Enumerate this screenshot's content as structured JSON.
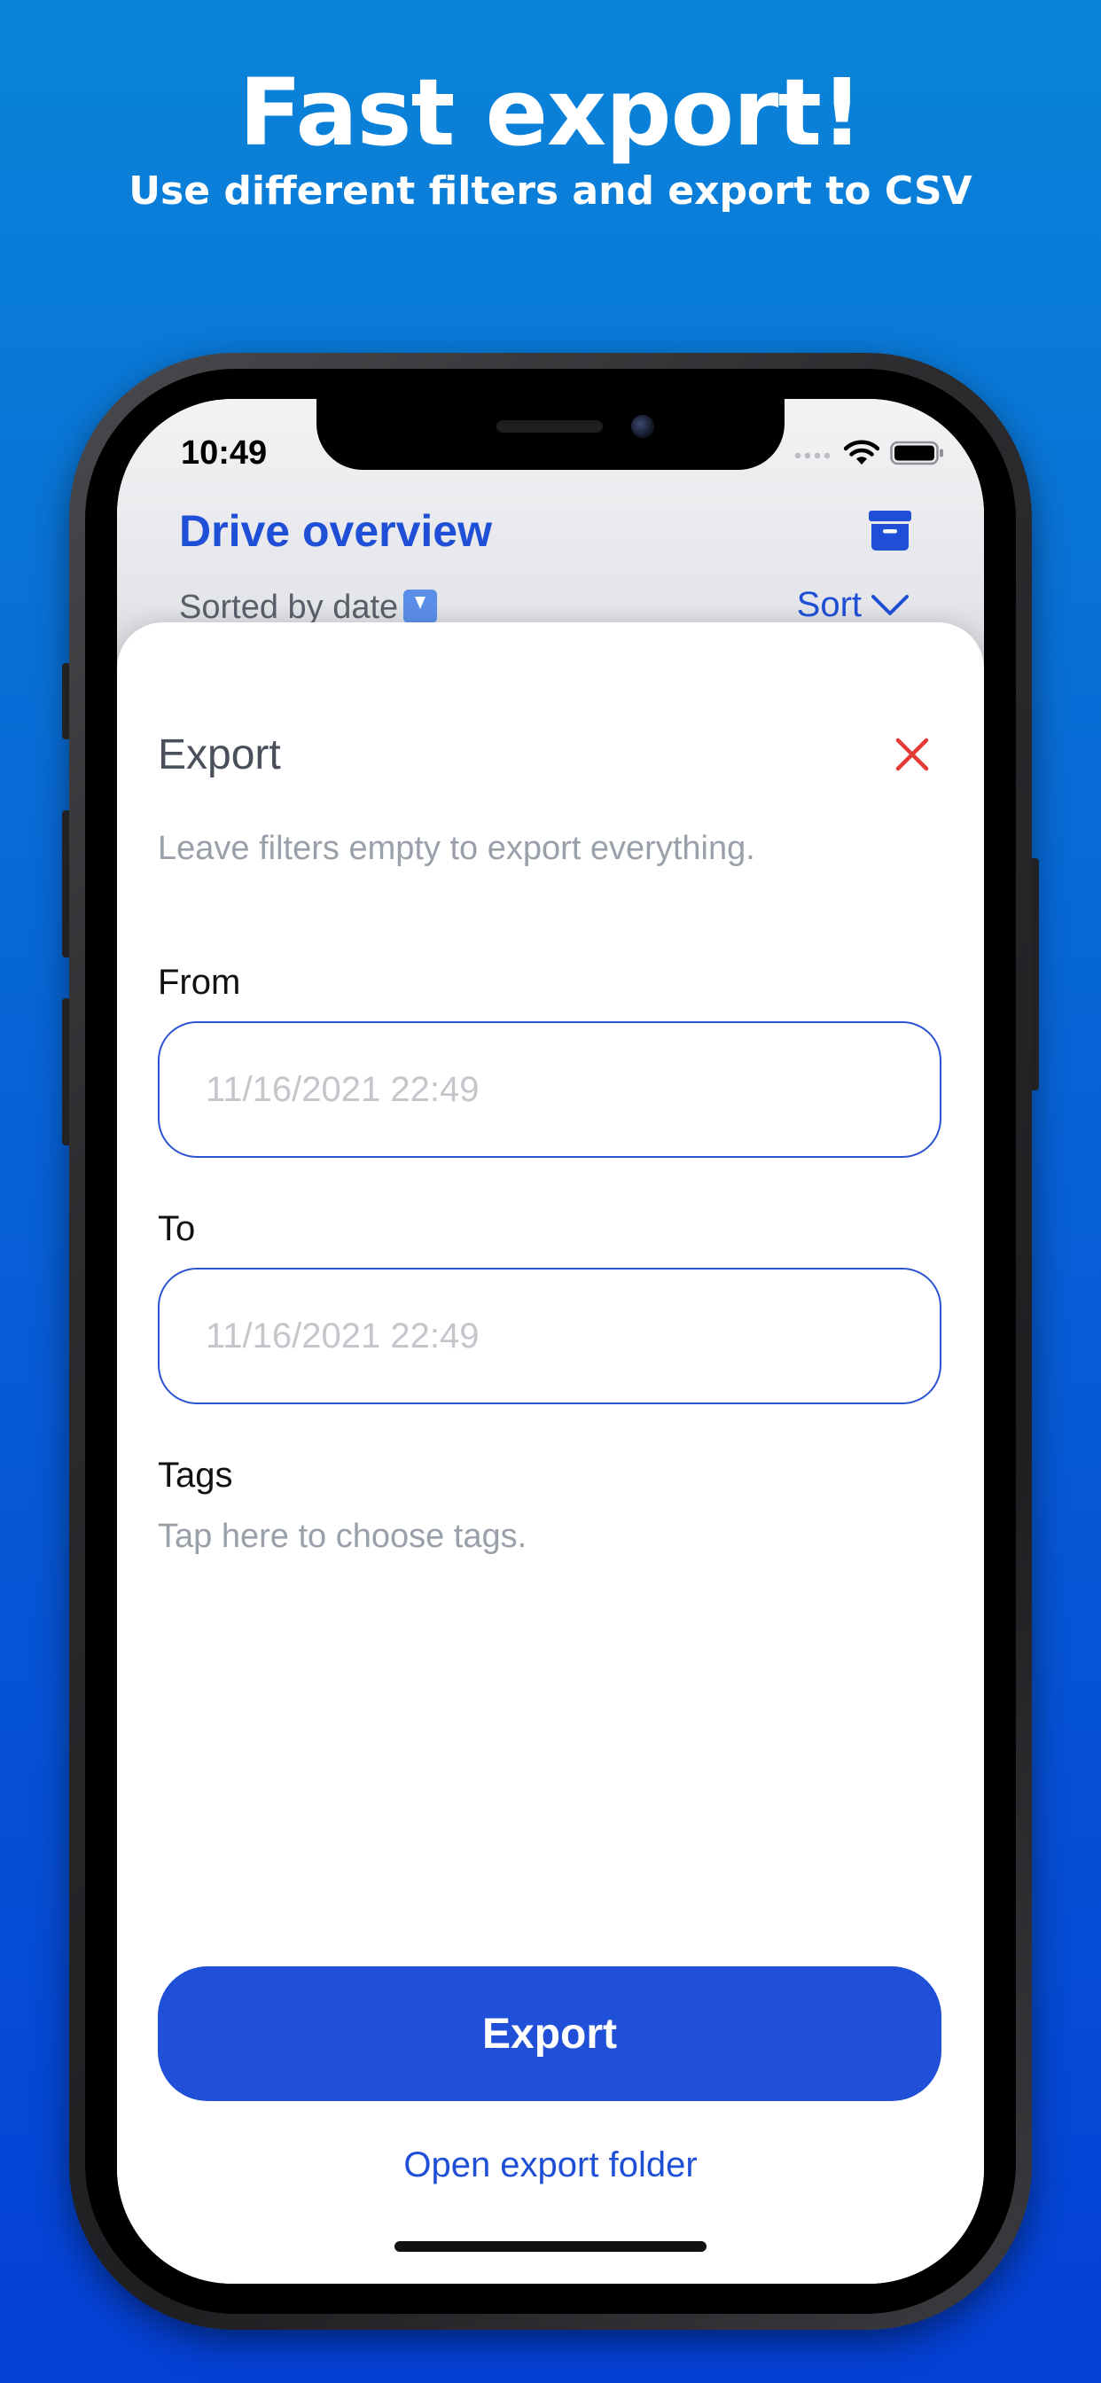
{
  "promo": {
    "headline": "Fast export!",
    "subheadline": "Use different filters and export to CSV"
  },
  "status_bar": {
    "time": "10:49"
  },
  "nav": {
    "title": "Drive overview",
    "sort_caption": "Sorted by date",
    "sort_label": "Sort"
  },
  "sheet": {
    "title": "Export",
    "hint": "Leave filters empty to export everything.",
    "from_label": "From",
    "from_placeholder": "11/16/2021 22:49",
    "to_label": "To",
    "to_placeholder": "11/16/2021 22:49",
    "tags_label": "Tags",
    "tags_hint": "Tap here to choose tags.",
    "export_button": "Export",
    "open_folder": "Open export folder"
  },
  "icons": {
    "archive": "archive-box-icon",
    "close": "close-x-icon",
    "sort_chevron": "chevron-down-icon",
    "wifi": "wifi-icon",
    "battery": "battery-icon",
    "signal": "cellular-signal-icon"
  },
  "colors": {
    "accent": "#1f4fd6",
    "button": "#2150d8",
    "close": "#e53935",
    "background_top": "#0a84d8",
    "background_bottom": "#0540d6"
  }
}
